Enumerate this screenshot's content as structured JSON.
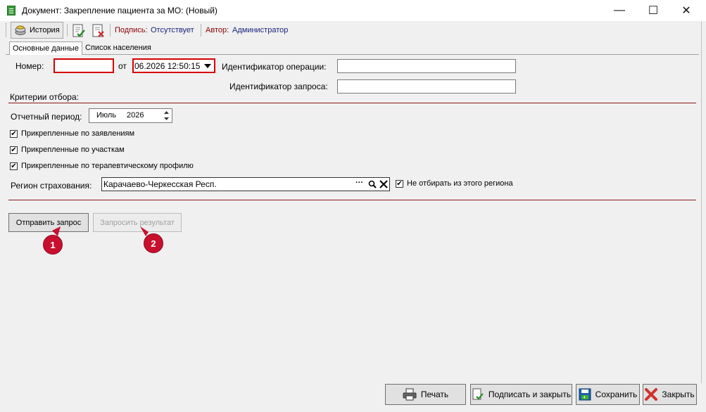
{
  "window": {
    "title": "Документ: Закрепление пациента за МО:  (Новый)",
    "minimize": "—",
    "maximize": "☐",
    "close": "✕"
  },
  "toolbar": {
    "history_label": "История",
    "signature_label": "Подпись:",
    "signature_value": "Отсутствует",
    "author_label": "Автор:",
    "author_value": "Администратор"
  },
  "tabs": [
    {
      "label": "Основные данные"
    },
    {
      "label": "Список населения"
    }
  ],
  "form": {
    "number_label": "Номер:",
    "number_value": "",
    "from_label": "от",
    "date_value": "06.2026 12:50:15",
    "operation_id_label": "Идентификатор операции:",
    "operation_id_value": "",
    "request_id_label": "Идентификатор запроса:",
    "request_id_value": "",
    "criteria_label": "Критерии отбора:",
    "period_label": "Отчетный период:",
    "period_month": "Июль",
    "period_year": "2026",
    "checkboxes": [
      {
        "label": "Прикрепленные по заявлениям",
        "checked": true
      },
      {
        "label": "Прикрепленные по участкам",
        "checked": true
      },
      {
        "label": "Прикрепленные по терапевтическому профилю",
        "checked": true
      }
    ],
    "region_label": "Регион страхования:",
    "region_value": "Карачаево-Черкесская Респ.",
    "region_more": "···",
    "exclude_region_label": "Не отбирать из этого региона",
    "exclude_region_checked": true
  },
  "actions": {
    "send_request": "Отправить запрос",
    "request_result": "Запросить результат",
    "badge1": "1",
    "badge2": "2"
  },
  "footer": {
    "print": "Печать",
    "sign_close": "Подписать и закрыть",
    "save": "Сохранить",
    "close": "Закрыть"
  },
  "colors": {
    "accent_red": "#c8102e",
    "divider": "#8b1a1a",
    "author_blue": "#1a237e"
  }
}
